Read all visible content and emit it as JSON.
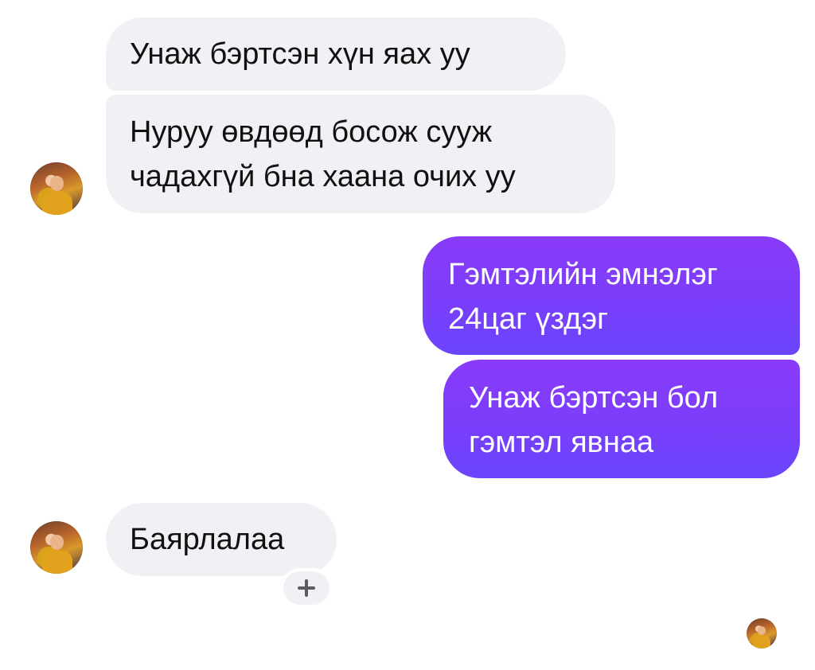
{
  "thread": {
    "messages": [
      {
        "side": "incoming",
        "text_lines": [
          "Унаж бэртсэн хүн яах уу"
        ]
      },
      {
        "side": "incoming",
        "text_lines": [
          "Нуруу өвдөөд босож сууж",
          "чадахгүй бна хаана очих уу"
        ]
      },
      {
        "side": "outgoing",
        "text_lines": [
          "Гэмтэлийн эмнэлэг",
          "24цаг үздэг"
        ]
      },
      {
        "side": "outgoing",
        "text_lines": [
          "Унаж бэртсэн бол",
          "гэмтэл явнаа"
        ]
      },
      {
        "side": "incoming",
        "text_lines": [
          "Баярлалаа"
        ]
      }
    ]
  },
  "icons": {
    "add_reaction": "plus-icon",
    "contact_avatar": "avatar",
    "read_receipt": "seen-avatar"
  },
  "colors": {
    "incoming_bubble": "#f0f1f5",
    "incoming_text": "#111111",
    "outgoing_gradient_top": "#8a3bfa",
    "outgoing_gradient_bottom": "#6a45fb",
    "outgoing_text": "#ffffff"
  }
}
